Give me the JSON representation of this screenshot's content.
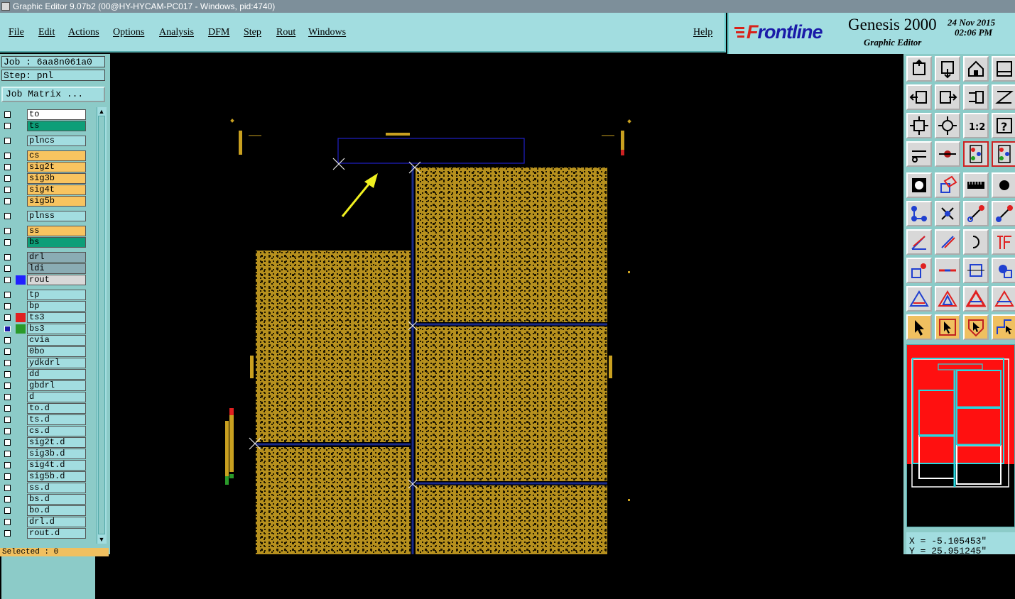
{
  "window": {
    "title": "Graphic Editor 9.07b2 (00@HY-HYCAM-PC017 - Windows, pid:4740)"
  },
  "menu": {
    "items": [
      "File",
      "Edit",
      "Actions",
      "Options",
      "Analysis",
      "DFM",
      "Step",
      "Rout",
      "Windows"
    ],
    "help": "Help"
  },
  "brand": {
    "logo_prefix": "F",
    "logo_rest": "rontline",
    "product": "Genesis 2000",
    "subtitle": "Graphic Editor",
    "date": "24 Nov 2015",
    "time": "02:06 PM"
  },
  "job": {
    "job_label": "Job : 6aa8n061a0",
    "step_label": "Step: pnl",
    "matrix_button": "Job Matrix ..."
  },
  "layers": [
    {
      "name": "to",
      "color": "#ffffff",
      "ind": ""
    },
    {
      "name": "ts",
      "color": "#0d9e78",
      "ind": ""
    },
    {
      "name": "plncs",
      "color": "#a2dde0",
      "ind": ""
    },
    {
      "name": "cs",
      "color": "#f8c460",
      "ind": ""
    },
    {
      "name": "sig2t",
      "color": "#f8c460",
      "ind": ""
    },
    {
      "name": "sig3b",
      "color": "#f8c460",
      "ind": ""
    },
    {
      "name": "sig4t",
      "color": "#f8c460",
      "ind": ""
    },
    {
      "name": "sig5b",
      "color": "#f8c460",
      "ind": ""
    },
    {
      "name": "plnss",
      "color": "#a2dde0",
      "ind": ""
    },
    {
      "name": "ss",
      "color": "#f8c460",
      "ind": ""
    },
    {
      "name": "bs",
      "color": "#0d9e78",
      "ind": ""
    },
    {
      "name": "drl",
      "color": "#8aacb4",
      "ind": ""
    },
    {
      "name": "ldi",
      "color": "#8aacb4",
      "ind": ""
    },
    {
      "name": "rout",
      "color": "#d8d8d8",
      "ind": "#2020ff"
    },
    {
      "name": "tp",
      "color": "#a2dde0",
      "ind": ""
    },
    {
      "name": "bp",
      "color": "#a2dde0",
      "ind": ""
    },
    {
      "name": "ts3",
      "color": "#a2dde0",
      "ind": "#e02020"
    },
    {
      "name": "bs3",
      "color": "#a2dde0",
      "ind": "#2a9a2a",
      "active": true
    },
    {
      "name": "cvia",
      "color": "#a2dde0",
      "ind": ""
    },
    {
      "name": "0bo",
      "color": "#a2dde0",
      "ind": ""
    },
    {
      "name": "ydkdrl",
      "color": "#a2dde0",
      "ind": ""
    },
    {
      "name": "dd",
      "color": "#a2dde0",
      "ind": ""
    },
    {
      "name": "gbdrl",
      "color": "#a2dde0",
      "ind": ""
    },
    {
      "name": "d",
      "color": "#a2dde0",
      "ind": ""
    },
    {
      "name": "to.d",
      "color": "#a2dde0",
      "ind": ""
    },
    {
      "name": "ts.d",
      "color": "#a2dde0",
      "ind": ""
    },
    {
      "name": "cs.d",
      "color": "#a2dde0",
      "ind": ""
    },
    {
      "name": "sig2t.d",
      "color": "#a2dde0",
      "ind": ""
    },
    {
      "name": "sig3b.d",
      "color": "#a2dde0",
      "ind": ""
    },
    {
      "name": "sig4t.d",
      "color": "#a2dde0",
      "ind": ""
    },
    {
      "name": "sig5b.d",
      "color": "#a2dde0",
      "ind": ""
    },
    {
      "name": "ss.d",
      "color": "#a2dde0",
      "ind": ""
    },
    {
      "name": "bs.d",
      "color": "#a2dde0",
      "ind": ""
    },
    {
      "name": "bo.d",
      "color": "#a2dde0",
      "ind": ""
    },
    {
      "name": "drl.d",
      "color": "#a2dde0",
      "ind": ""
    },
    {
      "name": "rout.d",
      "color": "#a2dde0",
      "ind": ""
    }
  ],
  "status": {
    "selected": "Selected : 0"
  },
  "coords": {
    "x": "X = -5.105453\"",
    "y": "Y = 25.951245\""
  },
  "tools": [
    "window-icon",
    "window-down-icon",
    "home-icon",
    "split-icon",
    "pan-left-icon",
    "pan-right-icon",
    "swap-icon",
    "redraw-icon",
    "fit-icon",
    "zoom-icon",
    "one-to-one-icon",
    "help-icon",
    "scissor-icon",
    "key-icon",
    "traffic-light-icon",
    "traffic-light-alt-icon",
    "pad-icon",
    "rectangle-icon",
    "ruler-icon",
    "dot-icon",
    "connect-icon",
    "cross-icon",
    "line-red-icon",
    "line-blue-icon",
    "angle-icon",
    "slash-icon",
    "arc-icon",
    "text-icon",
    "move-icon",
    "minus-icon",
    "dimension-icon",
    "group-icon",
    "triangle-icon",
    "triangle-outline-icon",
    "triangle-cut-icon",
    "triangle-x-icon",
    "pointer-icon",
    "pointer-box-icon",
    "pointer-shield-icon",
    "route-icon"
  ],
  "colors": {
    "panel": "#8ccbc8",
    "menu": "#a2dde0",
    "board": "#b6901e",
    "board_dots": "#1e1700",
    "highlight": "#f0c060"
  }
}
